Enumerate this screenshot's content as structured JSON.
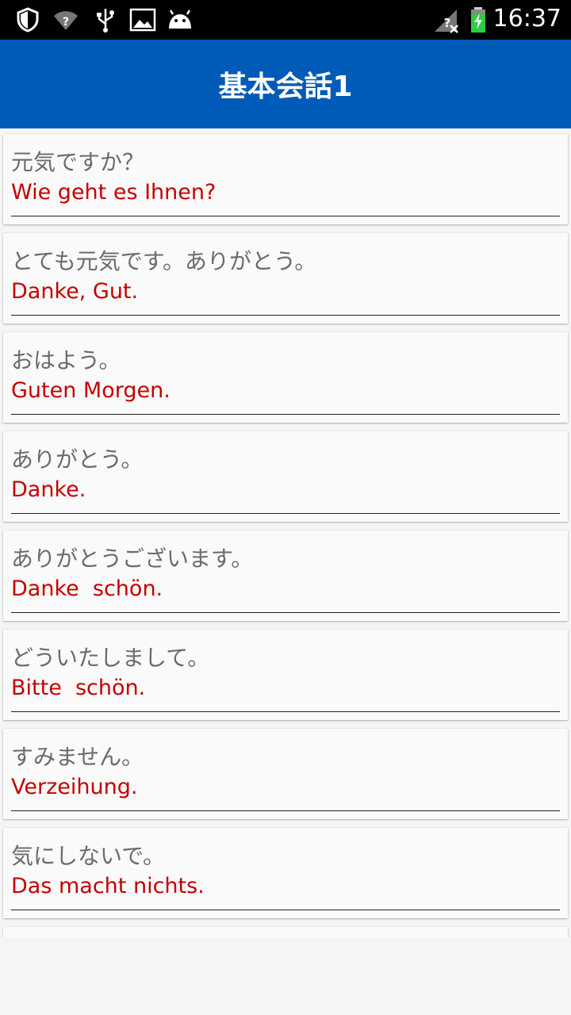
{
  "status_bar": {
    "time": "16:37",
    "left_icons": [
      "shield-icon",
      "wifi-question-icon",
      "usb-icon",
      "image-icon",
      "android-icon"
    ],
    "right_icons": [
      "no-signal-icon",
      "battery-charging-icon"
    ]
  },
  "app_bar": {
    "title": "基本会話1",
    "color": "#005bb8"
  },
  "phrases": [
    {
      "jp": "元気ですか？",
      "de": "Wie geht es Ihnen?"
    },
    {
      "jp": "とても元気です。ありがとう。",
      "de": "Danke, Gut."
    },
    {
      "jp": "おはよう。",
      "de": "Guten Morgen."
    },
    {
      "jp": "ありがとう。",
      "de": "Danke."
    },
    {
      "jp": "ありがとうございます。",
      "de": "Danke  schön."
    },
    {
      "jp": "どういたしまして。",
      "de": "Bitte  schön."
    },
    {
      "jp": "すみません。",
      "de": "Verzeihung."
    },
    {
      "jp": "気にしないで。",
      "de": "Das macht nichts."
    }
  ],
  "colors": {
    "japanese_text": "#6b6b6b",
    "german_text": "#c40000",
    "background": "#f5f5f5"
  }
}
